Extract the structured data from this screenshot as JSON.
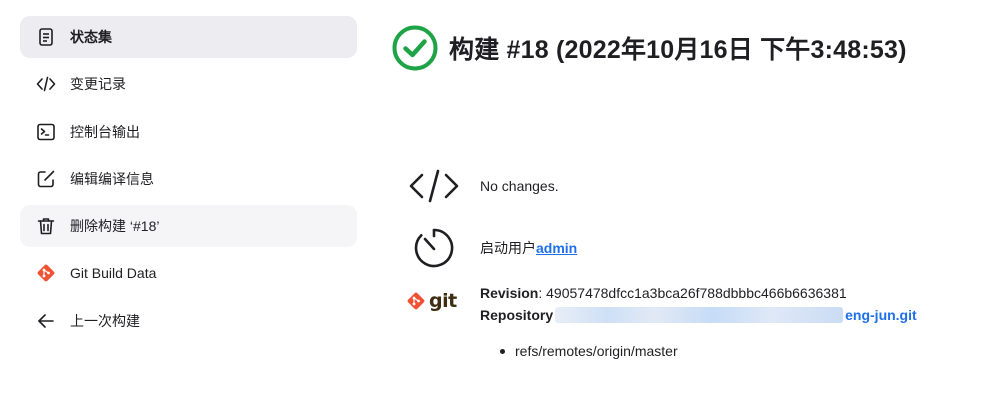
{
  "sidebar": {
    "items": [
      {
        "label": "状态集",
        "icon": "document-icon"
      },
      {
        "label": "变更记录",
        "icon": "code-icon"
      },
      {
        "label": "控制台输出",
        "icon": "terminal-icon"
      },
      {
        "label": "编辑编译信息",
        "icon": "edit-icon"
      },
      {
        "label": "删除构建 ‘#18’",
        "icon": "trash-icon"
      },
      {
        "label": "Git Build Data",
        "icon": "git-icon"
      },
      {
        "label": "上一次构建",
        "icon": "arrow-left-icon"
      }
    ]
  },
  "header": {
    "title": "构建 #18 (2022年10月16日 下午3:48:53)",
    "status_icon": "success-check-icon"
  },
  "changes": {
    "text": "No changes."
  },
  "started_by": {
    "prefix": "启动用户",
    "user": "admin"
  },
  "git": {
    "logo_text": "git",
    "revision_label": "Revision",
    "revision_value": ": 49057478dfcc1a3bca26f788dbbbc466b6636381",
    "repository_label": "Repository",
    "repository_tail": "eng-jun.git",
    "refs": [
      "refs/remotes/origin/master"
    ]
  },
  "colors": {
    "success": "#1ea446",
    "link": "#1f6feb",
    "git_orange": "#f05133"
  }
}
